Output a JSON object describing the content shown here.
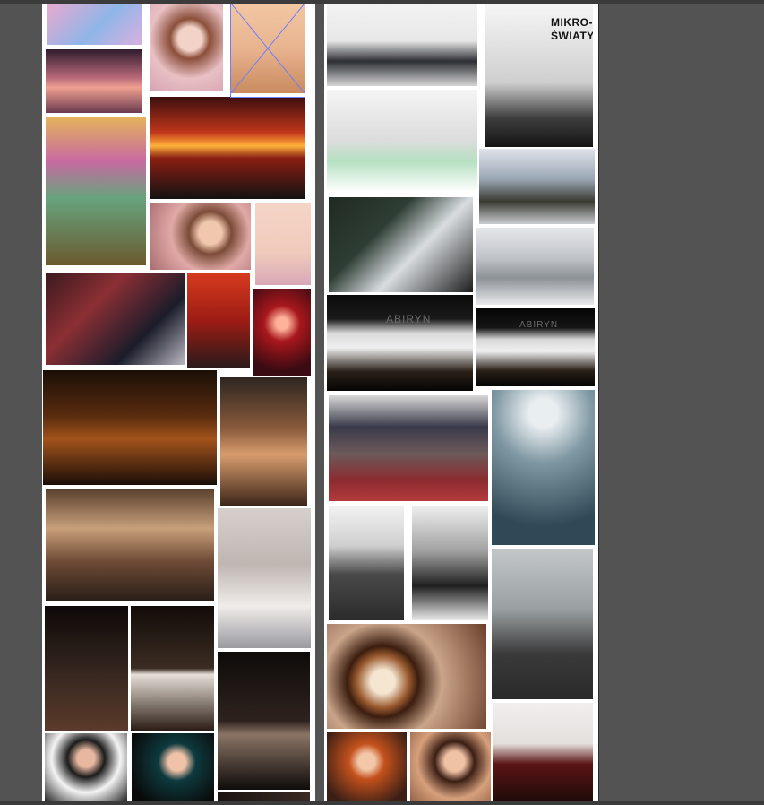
{
  "app": {
    "canvas_bg": "#535353",
    "artboard_bg": "#ffffff",
    "selection_color": "#6b7cff"
  },
  "left_board": {
    "photos": [
      {
        "id": "pink-bench",
        "bg": "linear-gradient(135deg,#e9a9d0 0%,#8fb6e8 55%,#d8b0e0 100%)"
      },
      {
        "id": "portrait-curly",
        "bg": "radial-gradient(circle at 55% 40%,#f3d2c7 0 18%,#8b4f3a 30%,#e9c0c4 60%,#d7a3b3 100%)"
      },
      {
        "id": "stool-girl",
        "bg": "linear-gradient(180deg,#f2c7a2 0%,#e8b490 50%,#c98a5e 100%)"
      },
      {
        "id": "sunset-girl-lying",
        "bg": "linear-gradient(180deg,#301c2e 0%,#b86a7a 45%,#f0a090 60%,#6a3a4f 100%)"
      },
      {
        "id": "graffiti-handstand",
        "bg": "linear-gradient(180deg,#e6b45b 0%,#c76aa1 30%,#66a37d 55%,#6c5a2f 100%)"
      },
      {
        "id": "lake-sunset",
        "bg": "linear-gradient(180deg,#3c0e0e 0%,#c2361b 35%,#ffb23a 48%,#8a1e12 60%,#121212 100%)"
      },
      {
        "id": "flower-portrait",
        "bg": "radial-gradient(circle at 60% 45%,#f1c8ae 0 16%,#7b4b37 30%,#e0a9a6 55%,#a86b70 100%)"
      },
      {
        "id": "pink-suit-sitting",
        "bg": "linear-gradient(180deg,#f5d5c8 0%,#f0cbbb 60%,#d9a8b8 100%)"
      },
      {
        "id": "brick-scarf",
        "bg": "linear-gradient(135deg,#3a1a1e 0%,#8b2f34 35%,#1b1c2a 70%,#b9b7c2 100%)"
      },
      {
        "id": "red-wall-book",
        "bg": "linear-gradient(180deg,#d63b1f 0%,#9e1c14 50%,#2a1a1a 100%)"
      },
      {
        "id": "red-bokeh-girl",
        "bg": "radial-gradient(circle at 50% 40%,#ffb199 0 10%,#a8171c 30%,#3a0b12 80%)"
      },
      {
        "id": "ghosts-forest",
        "bg": "linear-gradient(180deg,#1b0f07 0%,#5a2b0f 40%,#a3531b 60%,#1a0e08 100%)"
      },
      {
        "id": "shirtless-sunglasses",
        "bg": "linear-gradient(180deg,#2c2520 0%,#8a5a3c 40%,#d79c6d 60%,#3b2418 100%)"
      },
      {
        "id": "exhibition-hall",
        "bg": "linear-gradient(180deg,#5c4230 0%,#c7a07a 35%,#6e4a36 65%,#2a1f18 100%)"
      },
      {
        "id": "speaker-hall",
        "bg": "linear-gradient(180deg,#d6d0cd 0%,#bfb6b2 40%,#f0ecea 70%,#9a9a9f 100%)"
      },
      {
        "id": "suit-armchair-1",
        "bg": "linear-gradient(180deg,#0d0908 0%,#3b2a22 60%,#5b3b2a 100%)"
      },
      {
        "id": "suit-armchair-2",
        "bg": "linear-gradient(180deg,#120c09 0%,#3b2c22 50%,#e7e0d8 55%,#2b1d15 100%)"
      },
      {
        "id": "suit-armchair-3",
        "bg": "linear-gradient(180deg,#0e0b0a 0%,#2e221e 50%,#8a7464 60%,#0e0b0a 100%)"
      },
      {
        "id": "cow-print",
        "bg": "radial-gradient(circle at 50% 35%,#e7b7a0 0 14%,#1b1b1b 30%,#f4f4f4 55%,#0f0f0f 100%)"
      },
      {
        "id": "teal-eyeshadow",
        "bg": "radial-gradient(circle at 55% 40%,#f0c2a8 0 14%,#0d3a3e 30%,#0a0a0a 80%)"
      },
      {
        "id": "bottom-strip",
        "bg": "linear-gradient(90deg,#1a1412,#3a2a22)"
      }
    ]
  },
  "right_board": {
    "photos": [
      {
        "id": "speaker-gallery",
        "bg": "linear-gradient(180deg,#f2f2f2 0%,#e8e8e8 45%,#2e2f35 70%,#d5d5d5 100%)"
      },
      {
        "id": "mikro-swiaty",
        "bg": "linear-gradient(180deg,#f6f6f6 0%,#cfcfcf 55%,#3d3d3d 80%,#151515 100%)",
        "caption_line1": "MIKRO-",
        "caption_line2": "ŚWIATY"
      },
      {
        "id": "glasses-drawing",
        "bg": "linear-gradient(180deg,#f5f5f5 0%,#dcdcdc 50%,#b6e0c2 70%,#ffffff 100%)"
      },
      {
        "id": "gallery-group",
        "bg": "linear-gradient(180deg,#dfe3ea 0%,#9aa7b5 40%,#3a3a32 70%,#c9ccd1 100%)"
      },
      {
        "id": "gallery-viewers",
        "bg": "linear-gradient(135deg,#1f2a22 0%,#2e3d34 35%,#d9dde0 60%,#1d1d1d 100%)"
      },
      {
        "id": "gallery-corridor",
        "bg": "linear-gradient(180deg,#e6e7ea 0%,#bfc3c8 40%,#8c9196 65%,#e9eaec 100%)"
      },
      {
        "id": "panel-stage-1",
        "bg": "linear-gradient(180deg,#0a0a0a 0%,#1a1a1a 25%,#d9d9d9 40%,#f0f0f0 55%,#2a2018 80%,#050505 100%)",
        "screen_text": "ABIRYN"
      },
      {
        "id": "panel-stage-2",
        "bg": "linear-gradient(180deg,#050505 0%,#161616 25%,#d8d8d8 40%,#efefef 55%,#291f17 80%,#050505 100%)",
        "screen_text": "ABIRYN"
      },
      {
        "id": "gym-audience",
        "bg": "linear-gradient(180deg,#d8d8d8 0%,#3a3a4a 30%,#6c5a5a 55%,#8b2c30 80%,#b33a3b 100%)"
      },
      {
        "id": "backlit-dancer",
        "bg": "radial-gradient(circle at 50% 15%,#e9eef1 0 10%,#7f98a3 35%,#2f4a56 80%)"
      },
      {
        "id": "sweater-boy",
        "bg": "linear-gradient(180deg,#f2f2f2 0%,#cfcfcf 35%,#494949 60%,#2b2b2b 100%)"
      },
      {
        "id": "sitting-girl",
        "bg": "linear-gradient(180deg,#efefef 0%,#a0a0a0 40%,#1f1f1f 70%,#eaeaea 100%)"
      },
      {
        "id": "latte-art",
        "bg": "radial-gradient(circle at 35% 55%,#f5e6d2 0 10%,#9a5a2f 22%,#3b1d0f 30%,#caa58a 50%,#6b3f2b 100%)"
      },
      {
        "id": "profile-boy",
        "bg": "linear-gradient(180deg,#c3c7c8 0%,#9aa0a2 40%,#3a3a3a 70%,#2a2a2a 100%)"
      },
      {
        "id": "redhead-girl",
        "bg": "radial-gradient(circle at 50% 40%,#f3c7a9 0 14%,#c4511c 30%,#3b1f15 80%)"
      },
      {
        "id": "smiling-girl",
        "bg": "radial-gradient(circle at 55% 40%,#f0c2a4 0 16%,#3b1e14 32%,#d7a07c 60%,#8a5a40 100%)"
      },
      {
        "id": "bottle-glass",
        "bg": "linear-gradient(180deg,#f1efee 0%,#e3dfdc 40%,#5a1414 60%,#1a0b08 100%)"
      }
    ]
  }
}
